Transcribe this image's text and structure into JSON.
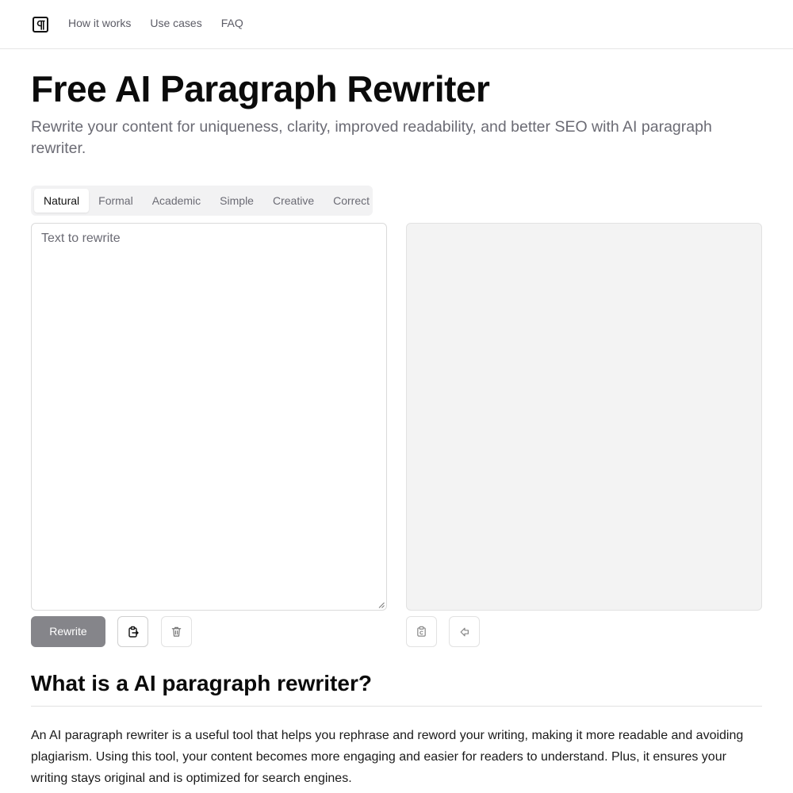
{
  "nav": {
    "logo_icon": "pilcrow-icon",
    "links": [
      "How it works",
      "Use cases",
      "FAQ"
    ]
  },
  "hero": {
    "title": "Free AI Paragraph Rewriter",
    "subtitle": "Rewrite your content for uniqueness, clarity, improved readability, and better SEO with AI paragraph rewriter."
  },
  "modes": {
    "tabs": [
      "Natural",
      "Formal",
      "Academic",
      "Simple",
      "Creative",
      "Correct"
    ],
    "selected": "Natural"
  },
  "editor": {
    "input_placeholder": "Text to rewrite",
    "input_value": "",
    "output_value": ""
  },
  "actions": {
    "rewrite_label": "Rewrite",
    "paste_icon": "clipboard-paste-icon",
    "clear_icon": "trash-icon",
    "copy_icon": "clipboard-copy-icon",
    "use_output_icon": "arrow-left-icon"
  },
  "info": {
    "heading": "What is a AI paragraph rewriter?",
    "paragraph": "An AI paragraph rewriter is a useful tool that helps you rephrase and reword your writing, making it more readable and avoiding plagiarism. Using this tool, your content becomes more engaging and easier for readers to understand. Plus, it ensures your writing stays original and is optimized for search engines."
  },
  "colors": {
    "primary_button": "#85858a",
    "output_background": "#f3f3f3",
    "muted_text": "#6b6b74"
  }
}
